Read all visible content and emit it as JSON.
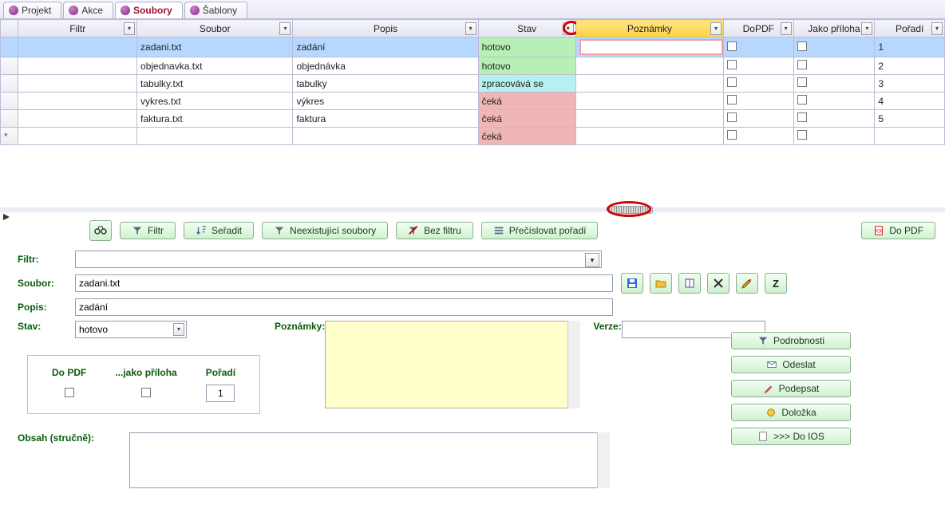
{
  "tabs": [
    {
      "label": "Projekt",
      "active": false
    },
    {
      "label": "Akce",
      "active": false
    },
    {
      "label": "Soubory",
      "active": true
    },
    {
      "label": "Šablony",
      "active": false
    }
  ],
  "columns": {
    "filtr": "Filtr",
    "soubor": "Soubor",
    "popis": "Popis",
    "stav": "Stav",
    "poznamky": "Poznámky",
    "dopdf": "DoPDF",
    "jako": "Jako příloha",
    "poradi": "Pořadí"
  },
  "rows": [
    {
      "soubor": "zadani.txt",
      "popis": "zadání",
      "stav": "hotovo",
      "stav_class": "hotovo",
      "dopdf": false,
      "jako": false,
      "poradi": "1",
      "sel": true
    },
    {
      "soubor": "objednavka.txt",
      "popis": "objednávka",
      "stav": "hotovo",
      "stav_class": "hotovo",
      "dopdf": false,
      "jako": false,
      "poradi": "2",
      "sel": false
    },
    {
      "soubor": "tabulky.txt",
      "popis": "tabulky",
      "stav": "zpracovává se",
      "stav_class": "zprac",
      "dopdf": false,
      "jako": false,
      "poradi": "3",
      "sel": false
    },
    {
      "soubor": "vykres.txt",
      "popis": "výkres",
      "stav": "čeká",
      "stav_class": "ceka",
      "dopdf": false,
      "jako": false,
      "poradi": "4",
      "sel": false
    },
    {
      "soubor": "faktura.txt",
      "popis": "faktura",
      "stav": "čeká",
      "stav_class": "ceka",
      "dopdf": false,
      "jako": false,
      "poradi": "5",
      "sel": false
    }
  ],
  "new_row_stav": "čeká",
  "toolbar": {
    "filtr": "Filtr",
    "seradit": "Seřadit",
    "neex": "Neexistující soubory",
    "bezfiltru": "Bez filtru",
    "precislovat": "Přečíslovat pořadí",
    "dopdf": "Do PDF"
  },
  "labels": {
    "filtr": "Filtr:",
    "soubor": "Soubor:",
    "popis": "Popis:",
    "stav": "Stav:",
    "poznamky": "Poznámky:",
    "verze": "Verze:",
    "obsah": "Obsah (stručně):",
    "dopdf": "Do PDF",
    "jakopriloha": "...jako příloha",
    "poradi": "Pořadí"
  },
  "detail": {
    "soubor": "zadani.txt",
    "popis": "zadání",
    "stav": "hotovo",
    "poradi": "1",
    "z_btn": "Z"
  },
  "actions": {
    "podrobnosti": "Podrobnosti",
    "odeslat": "Odeslat",
    "podepsat": "Podepsat",
    "dolozka": "Doložka",
    "doios": ">>> Do IOS"
  }
}
